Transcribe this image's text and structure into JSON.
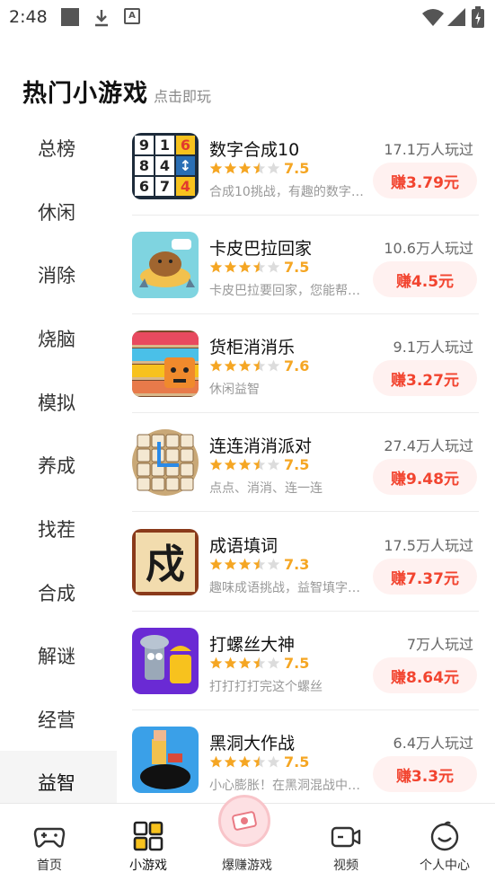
{
  "status_bar": {
    "time": "2:48"
  },
  "header": {
    "title": "热门小游戏",
    "subtitle": "点击即玩"
  },
  "sidebar": {
    "items": [
      {
        "label": "总榜",
        "active": false
      },
      {
        "label": "休闲",
        "active": false
      },
      {
        "label": "消除",
        "active": false
      },
      {
        "label": "烧脑",
        "active": false
      },
      {
        "label": "模拟",
        "active": false
      },
      {
        "label": "养成",
        "active": false
      },
      {
        "label": "找茬",
        "active": false
      },
      {
        "label": "合成",
        "active": false
      },
      {
        "label": "解谜",
        "active": false
      },
      {
        "label": "经营",
        "active": false
      },
      {
        "label": "益智",
        "active": true
      }
    ]
  },
  "games": [
    {
      "name": "数字合成10",
      "rating": "7.5",
      "stars": 3.5,
      "desc": "合成10挑战，有趣的数字…",
      "players": "17.1万人玩过",
      "earn": "赚3.79元",
      "icon": "number-puzzle-icon"
    },
    {
      "name": "卡皮巴拉回家",
      "rating": "7.5",
      "stars": 3.5,
      "desc": "卡皮巴拉要回家，您能帮…",
      "players": "10.6万人玩过",
      "earn": "赚4.5元",
      "icon": "capybara-icon"
    },
    {
      "name": "货柜消消乐",
      "rating": "7.6",
      "stars": 3.5,
      "desc": "休闲益智",
      "players": "9.1万人玩过",
      "earn": "赚3.27元",
      "icon": "shelf-icon"
    },
    {
      "name": "连连消消派对",
      "rating": "7.5",
      "stars": 3.5,
      "desc": "点点、消消、连一连",
      "players": "27.4万人玩过",
      "earn": "赚9.48元",
      "icon": "tile-match-icon"
    },
    {
      "name": "成语填词",
      "rating": "7.3",
      "stars": 3.5,
      "desc": "趣味成语挑战，益智填字…",
      "players": "17.5万人玩过",
      "earn": "赚7.37元",
      "icon": "idiom-icon"
    },
    {
      "name": "打螺丝大神",
      "rating": "7.5",
      "stars": 3.5,
      "desc": "打打打打完这个螺丝",
      "players": "7万人玩过",
      "earn": "赚8.64元",
      "icon": "screw-icon"
    },
    {
      "name": "黑洞大作战",
      "rating": "7.5",
      "stars": 3.5,
      "desc": "小心膨胀！在黑洞混战中…",
      "players": "6.4万人玩过",
      "earn": "赚3.3元",
      "icon": "black-hole-icon"
    }
  ],
  "bottom_nav": [
    {
      "label": "首页",
      "icon": "gamepad-icon"
    },
    {
      "label": "小游戏",
      "icon": "grid-icon"
    },
    {
      "label": "爆赚游戏",
      "icon": "money-icon"
    },
    {
      "label": "视频",
      "icon": "video-icon"
    },
    {
      "label": "个人中心",
      "icon": "smile-icon"
    }
  ],
  "colors": {
    "accent_red": "#f2442f",
    "star": "#f5a623",
    "earn_bg": "#fff1f0"
  }
}
